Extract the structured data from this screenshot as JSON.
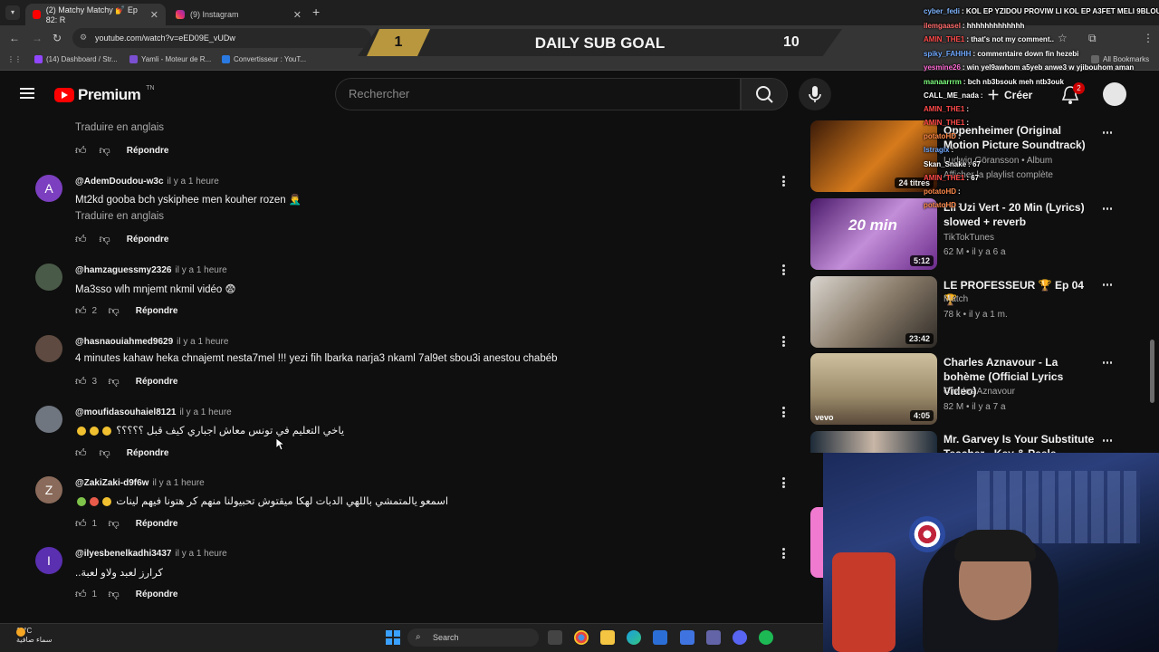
{
  "browser": {
    "tabs": [
      {
        "label": "(2) Matchy Matchy 💅 Ep 82: R",
        "active": true
      },
      {
        "label": "(9) Instagram",
        "active": false
      }
    ],
    "url": "youtube.com/watch?v=eED09E_vUDw",
    "bookmarks": [
      "(14) Dashboard / Str...",
      "Yamli - Moteur de R...",
      "Convertisseur : YouT..."
    ],
    "bookmarks_right": "All Bookmarks"
  },
  "goal": {
    "left": "1",
    "title": "DAILY SUB GOAL",
    "right": "10"
  },
  "youtube": {
    "logo": "Premium",
    "logo_sup": "TN",
    "search_placeholder": "Rechercher",
    "create_label": "Créer",
    "notif_count": "2"
  },
  "comments": {
    "partial_translate": "Traduire en anglais",
    "reply_label": "Répondre",
    "items": [
      {
        "initial": "A",
        "user": "@AdemDoudou-w3c",
        "time": "il y a 1 heure",
        "text": "Mt2kd gooba bch yskiphee men kouher rozen 🤦‍♂️",
        "translate": "Traduire en anglais",
        "likes": ""
      },
      {
        "initial": "",
        "user": "@hamzaguessmy2326",
        "time": "il y a 1 heure",
        "text": "Ma3sso wlh mnjemt nkmil vidéo 😨",
        "translate": "",
        "likes": "2"
      },
      {
        "initial": "",
        "user": "@hasnaouiahmed9629",
        "time": "il y a 1 heure",
        "text": "4 minutes kahaw heka chnajemt nesta7mel !!! yezi fih lbarka narja3 nkaml 7al9et sbou3i anestou chabéb",
        "translate": "",
        "likes": "3"
      },
      {
        "initial": "",
        "user": "@moufidasouhaiel8121",
        "time": "il y a 1 heure",
        "text": "ياخي التعليم في تونس معاش اجباري كيف قبل ؟؟؟؟؟",
        "translate": "",
        "likes": ""
      },
      {
        "initial": "Z",
        "user": "@ZakiZaki-d9f6w",
        "time": "il y a 1 heure",
        "text": "اسمعو يالمتمشي باللهي الدبات لهكا ميقتوش تحبيولنا منهم كر هتونا فيهم لينات",
        "translate": "",
        "likes": "1"
      },
      {
        "initial": "I",
        "user": "@ilyesbenelkadhi3437",
        "time": "il y a 1 heure",
        "text": "كرارز لعبد ولاو لعبة..",
        "translate": "",
        "likes": "1"
      }
    ]
  },
  "sidebar": {
    "videos": [
      {
        "title": "Oppenheimer (Original Motion Picture Soundtrack)",
        "meta1": "Ludwig Göransson • Album",
        "meta2": "Afficher la playlist complète",
        "duration": "24 titres"
      },
      {
        "title": "Lil Uzi Vert - 20 Min (Lyrics) slowed + reverb",
        "meta1": "TikTokTunes",
        "meta2": "62 M • il y a 6 a",
        "duration": "5:12",
        "thumb_text": "20 min"
      },
      {
        "title": "LE PROFESSEUR 🏆 Ep 04 🏆",
        "meta1": "Match",
        "meta2": "78 k • il y a 1 m.",
        "duration": "23:42"
      },
      {
        "title": "Charles Aznavour - La bohème (Official Lyrics Video)",
        "meta1": "Charles Aznavour",
        "meta2": "82 M • il y a 7 a",
        "duration": "4:05",
        "thumb_text": "vevo"
      },
      {
        "title": "Mr. Garvey Is Your Substitute Teacher - Key & Peele",
        "meta1": "",
        "meta2": "",
        "duration": ""
      }
    ]
  },
  "chat": [
    {
      "name": "cyber_fedi",
      "msg": ": KOL EP YZIDOU PROVIW LI KOL EP A3FET MELI 9BLOU",
      "color": "#7fb5ff"
    },
    {
      "name": "ilemgaasel",
      "msg": ": hhhhhhhhhhhhh",
      "color": "#ff6a6a"
    },
    {
      "name": "AMIN_THE1",
      "msg": ": that's not my comment..",
      "color": "#ff4a4a"
    },
    {
      "name": "spiky_FAHHH",
      "msg": ": commentaire down fin hezebi",
      "color": "#6fa8ff"
    },
    {
      "name": "yesmine26",
      "msg": ": win yel9awhom a5yeb anwe3 w yjibouhom aman",
      "color": "#ff6ad5"
    },
    {
      "name": "manaarrrm",
      "msg": ": bch nb3bsouk meh ntb3ouk",
      "color": "#7dff7d"
    },
    {
      "name": "CALL_ME_nada",
      "msg": ":",
      "color": "#ffffff"
    },
    {
      "name": "AMIN_THE1",
      "msg": ":",
      "color": "#ff4a4a"
    },
    {
      "name": "AMIN_THE1",
      "msg": ":",
      "color": "#ff4a4a"
    },
    {
      "name": "potatoHD",
      "msg": ":",
      "color": "#ff8a4a"
    },
    {
      "name": "lstragix",
      "msg": ":",
      "color": "#6fa8ff"
    },
    {
      "name": "Skan_Snake",
      "msg": ": 67",
      "color": "#ffffff"
    },
    {
      "name": "AMIN_THE1",
      "msg": ": 67",
      "color": "#ff4a4a"
    },
    {
      "name": "potatoHD",
      "msg": ":",
      "color": "#ff8a4a"
    },
    {
      "name": "potatoHD",
      "msg": ":",
      "color": "#ff8a4a"
    }
  ],
  "taskbar": {
    "weather_temp": "11°C",
    "weather_desc": "سماء صافية",
    "search_label": "Search"
  }
}
